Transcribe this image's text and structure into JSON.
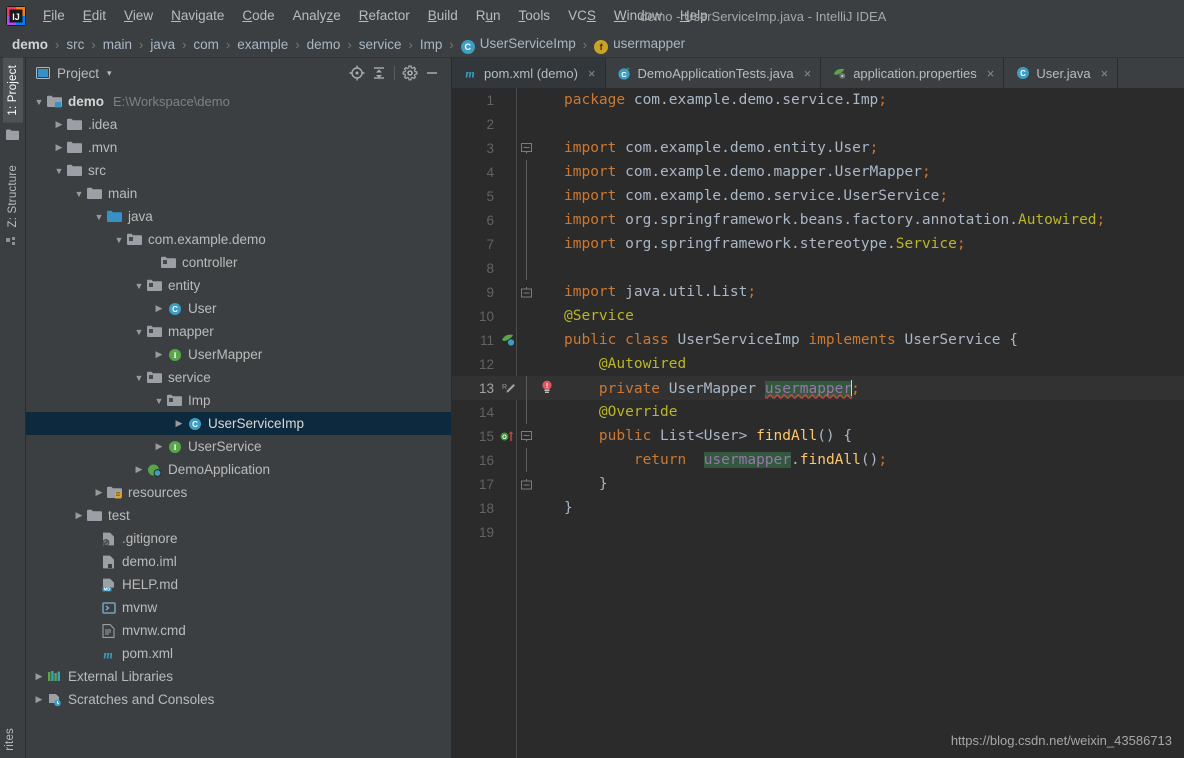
{
  "window": {
    "title": "demo - UserServiceImp.java - IntelliJ IDEA",
    "logo_icon": "intellij-idea-logo"
  },
  "menubar": {
    "items": [
      {
        "label": "File",
        "mnemonic": "F"
      },
      {
        "label": "Edit",
        "mnemonic": "E"
      },
      {
        "label": "View",
        "mnemonic": "V"
      },
      {
        "label": "Navigate",
        "mnemonic": "N"
      },
      {
        "label": "Code",
        "mnemonic": "C"
      },
      {
        "label": "Analyze",
        "mnemonic": "z"
      },
      {
        "label": "Refactor",
        "mnemonic": "R"
      },
      {
        "label": "Build",
        "mnemonic": "B"
      },
      {
        "label": "Run",
        "mnemonic": "u"
      },
      {
        "label": "Tools",
        "mnemonic": "T"
      },
      {
        "label": "VCS",
        "mnemonic": "S"
      },
      {
        "label": "Window",
        "mnemonic": "W"
      },
      {
        "label": "Help",
        "mnemonic": "H"
      }
    ]
  },
  "breadcrumb": {
    "separator": "›",
    "items": [
      {
        "label": "demo",
        "icon": null,
        "bold": true
      },
      {
        "label": "src",
        "icon": null,
        "bold": false
      },
      {
        "label": "main",
        "icon": null,
        "bold": false
      },
      {
        "label": "java",
        "icon": null,
        "bold": false
      },
      {
        "label": "com",
        "icon": null,
        "bold": false
      },
      {
        "label": "example",
        "icon": null,
        "bold": false
      },
      {
        "label": "demo",
        "icon": null,
        "bold": false
      },
      {
        "label": "service",
        "icon": null,
        "bold": false
      },
      {
        "label": "Imp",
        "icon": null,
        "bold": false
      },
      {
        "label": "UserServiceImp",
        "icon": "class-icon",
        "icon_letter": "C",
        "bold": false
      },
      {
        "label": "usermapper",
        "icon": "field-icon",
        "icon_letter": "f",
        "bold": false
      }
    ]
  },
  "toolstrip": {
    "tabs": [
      {
        "label": "1: Project",
        "icon": "project-folder-icon",
        "active": true
      },
      {
        "label": "Z: Structure",
        "icon": "structure-icon",
        "active": false
      }
    ],
    "bottom_tab": {
      "label": "rites",
      "icon": "favorites-icon"
    }
  },
  "project_panel": {
    "title": "Project",
    "title_icon": "project-view-icon",
    "dropdown_caret": "▾",
    "toolbar": [
      {
        "name": "scroll-from-source-icon",
        "tooltip": "Select Opened File"
      },
      {
        "name": "collapse-all-icon",
        "tooltip": "Collapse All"
      },
      {
        "name": "gear-icon",
        "tooltip": "Settings"
      },
      {
        "name": "minimize-icon",
        "tooltip": "Hide"
      }
    ],
    "tree": [
      {
        "label": "demo",
        "suffix": "E:\\Workspace\\demo",
        "indent": 0,
        "arrow": "down",
        "icon": "module-folder-icon",
        "bold": true,
        "selected": false
      },
      {
        "label": ".idea",
        "suffix": "",
        "indent": 1,
        "arrow": "right",
        "icon": "folder-icon",
        "bold": false,
        "selected": false
      },
      {
        "label": ".mvn",
        "suffix": "",
        "indent": 1,
        "arrow": "right",
        "icon": "folder-icon",
        "bold": false,
        "selected": false
      },
      {
        "label": "src",
        "suffix": "",
        "indent": 1,
        "arrow": "down",
        "icon": "folder-icon",
        "bold": false,
        "selected": false
      },
      {
        "label": "main",
        "suffix": "",
        "indent": 2,
        "arrow": "down",
        "icon": "folder-icon",
        "bold": false,
        "selected": false
      },
      {
        "label": "java",
        "suffix": "",
        "indent": 3,
        "arrow": "down",
        "icon": "source-root-icon",
        "bold": false,
        "selected": false
      },
      {
        "label": "com.example.demo",
        "suffix": "",
        "indent": 4,
        "arrow": "down",
        "icon": "package-icon",
        "bold": false,
        "selected": false
      },
      {
        "label": "controller",
        "suffix": "",
        "indent": 5,
        "arrow": "none",
        "icon": "package-icon",
        "bold": false,
        "selected": false
      },
      {
        "label": "entity",
        "suffix": "",
        "indent": 5,
        "arrow": "down",
        "icon": "package-icon",
        "bold": false,
        "selected": false
      },
      {
        "label": "User",
        "suffix": "",
        "indent": 6,
        "arrow": "right",
        "icon": "class-icon",
        "bold": false,
        "selected": false
      },
      {
        "label": "mapper",
        "suffix": "",
        "indent": 5,
        "arrow": "down",
        "icon": "package-icon",
        "bold": false,
        "selected": false
      },
      {
        "label": "UserMapper",
        "suffix": "",
        "indent": 6,
        "arrow": "right",
        "icon": "interface-icon",
        "bold": false,
        "selected": false
      },
      {
        "label": "service",
        "suffix": "",
        "indent": 5,
        "arrow": "down",
        "icon": "package-icon",
        "bold": false,
        "selected": false
      },
      {
        "label": "Imp",
        "suffix": "",
        "indent": 6,
        "arrow": "down",
        "icon": "package-icon",
        "bold": false,
        "selected": false
      },
      {
        "label": "UserServiceImp",
        "suffix": "",
        "indent": 7,
        "arrow": "right",
        "icon": "class-icon",
        "bold": false,
        "selected": true
      },
      {
        "label": "UserService",
        "suffix": "",
        "indent": 6,
        "arrow": "right",
        "icon": "interface-icon",
        "bold": false,
        "selected": false
      },
      {
        "label": "DemoApplication",
        "suffix": "",
        "indent": 5,
        "arrow": "right",
        "icon": "spring-class-icon",
        "bold": false,
        "selected": false
      },
      {
        "label": "resources",
        "suffix": "",
        "indent": 3,
        "arrow": "right",
        "icon": "resources-root-icon",
        "bold": false,
        "selected": false
      },
      {
        "label": "test",
        "suffix": "",
        "indent": 2,
        "arrow": "right",
        "icon": "folder-icon",
        "bold": false,
        "selected": false
      },
      {
        "label": ".gitignore",
        "suffix": "",
        "indent": 2,
        "arrow": "none",
        "icon": "gitignore-file-icon",
        "bold": false,
        "selected": false
      },
      {
        "label": "demo.iml",
        "suffix": "",
        "indent": 2,
        "arrow": "none",
        "icon": "iml-file-icon",
        "bold": false,
        "selected": false
      },
      {
        "label": "HELP.md",
        "suffix": "",
        "indent": 2,
        "arrow": "none",
        "icon": "markdown-file-icon",
        "bold": false,
        "selected": false
      },
      {
        "label": "mvnw",
        "suffix": "",
        "indent": 2,
        "arrow": "none",
        "icon": "shell-script-icon",
        "bold": false,
        "selected": false
      },
      {
        "label": "mvnw.cmd",
        "suffix": "",
        "indent": 2,
        "arrow": "none",
        "icon": "cmd-file-icon",
        "bold": false,
        "selected": false
      },
      {
        "label": "pom.xml",
        "suffix": "",
        "indent": 2,
        "arrow": "none",
        "icon": "maven-file-icon",
        "bold": false,
        "selected": false
      },
      {
        "label": "External Libraries",
        "suffix": "",
        "indent": 0,
        "arrow": "right",
        "icon": "libraries-icon",
        "bold": false,
        "selected": false
      },
      {
        "label": "Scratches and Consoles",
        "suffix": "",
        "indent": 0,
        "arrow": "right",
        "icon": "scratches-icon",
        "bold": false,
        "selected": false
      }
    ]
  },
  "editor": {
    "tabs": [
      {
        "label": "pom.xml (demo)",
        "icon": "maven-file-icon",
        "active": false,
        "close": "×"
      },
      {
        "label": "DemoApplicationTests.java",
        "icon": "test-class-icon",
        "active": false,
        "close": "×"
      },
      {
        "label": "application.properties",
        "icon": "spring-properties-icon",
        "active": false,
        "close": "×"
      },
      {
        "label": "User.java",
        "icon": "class-icon",
        "active": false,
        "close": "×"
      }
    ],
    "current_line": 13,
    "lines": [
      {
        "n": "1",
        "fold": "",
        "mark": "",
        "err": false
      },
      {
        "n": "2",
        "fold": "",
        "mark": "",
        "err": false
      },
      {
        "n": "3",
        "fold": "start",
        "mark": "",
        "err": false
      },
      {
        "n": "4",
        "fold": "bar",
        "mark": "",
        "err": false
      },
      {
        "n": "5",
        "fold": "bar",
        "mark": "",
        "err": false
      },
      {
        "n": "6",
        "fold": "bar",
        "mark": "",
        "err": false
      },
      {
        "n": "7",
        "fold": "bar",
        "mark": "",
        "err": false
      },
      {
        "n": "8",
        "fold": "bar",
        "mark": "",
        "err": false
      },
      {
        "n": "9",
        "fold": "end",
        "mark": "",
        "err": false
      },
      {
        "n": "10",
        "fold": "",
        "mark": "",
        "err": false
      },
      {
        "n": "11",
        "fold": "",
        "mark": "spring-bean-icon",
        "err": false
      },
      {
        "n": "12",
        "fold": "",
        "mark": "",
        "err": false
      },
      {
        "n": "13",
        "fold": "bar",
        "mark": "rename-refactor-icon",
        "err": true
      },
      {
        "n": "14",
        "fold": "bar",
        "mark": "",
        "err": false
      },
      {
        "n": "15",
        "fold": "start",
        "mark": "implements-method-icon",
        "err": false
      },
      {
        "n": "16",
        "fold": "bar",
        "mark": "",
        "err": false
      },
      {
        "n": "17",
        "fold": "end",
        "mark": "",
        "err": false
      },
      {
        "n": "18",
        "fold": "bar",
        "mark": "",
        "err": false
      },
      {
        "n": "19",
        "fold": "",
        "mark": "",
        "err": false
      }
    ],
    "code": [
      "package com.example.demo.service.Imp;",
      "",
      "import com.example.demo.entity.User;",
      "import com.example.demo.mapper.UserMapper;",
      "import com.example.demo.service.UserService;",
      "import org.springframework.beans.factory.annotation.Autowired;",
      "import org.springframework.stereotype.Service;",
      "",
      "import java.util.List;",
      "@Service",
      "public class UserServiceImp implements UserService {",
      "    @Autowired",
      "    private UserMapper usermapper;",
      "    @Override",
      "    public List<User> findAll() {",
      "        return  usermapper.findAll();",
      "    }",
      "}",
      ""
    ]
  },
  "watermark": {
    "text": "https://blog.csdn.net/weixin_43586713"
  },
  "colors": {
    "chrome": "#3c3f41",
    "editor_bg": "#2b2b2b",
    "selection": "#0d293e",
    "keyword": "#cc7832",
    "annotation": "#bbb529",
    "field": "#9876aa",
    "method": "#ffc66d",
    "text": "#a9b7c6",
    "usage_highlight": "#32593d",
    "error": "#cc4444"
  }
}
